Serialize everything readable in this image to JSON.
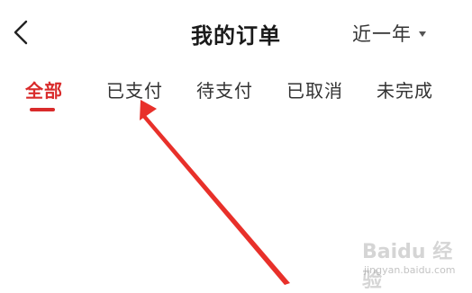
{
  "header": {
    "back_icon": "chevron-left-icon",
    "title": "我的订单",
    "range_label": "近一年",
    "range_icon": "caret-down-icon"
  },
  "tabs": [
    {
      "label": "全部",
      "active": true
    },
    {
      "label": "已支付",
      "active": false
    },
    {
      "label": "待支付",
      "active": false
    },
    {
      "label": "已取消",
      "active": false
    },
    {
      "label": "未完成",
      "active": false
    }
  ],
  "colors": {
    "accent": "#d92b2b",
    "text": "#333333",
    "title": "#1a1a1a",
    "annotation_arrow": "#e8302a"
  },
  "watermark": {
    "logo_text": "Baidu 经验",
    "url": "jingyan.baidu.com"
  }
}
